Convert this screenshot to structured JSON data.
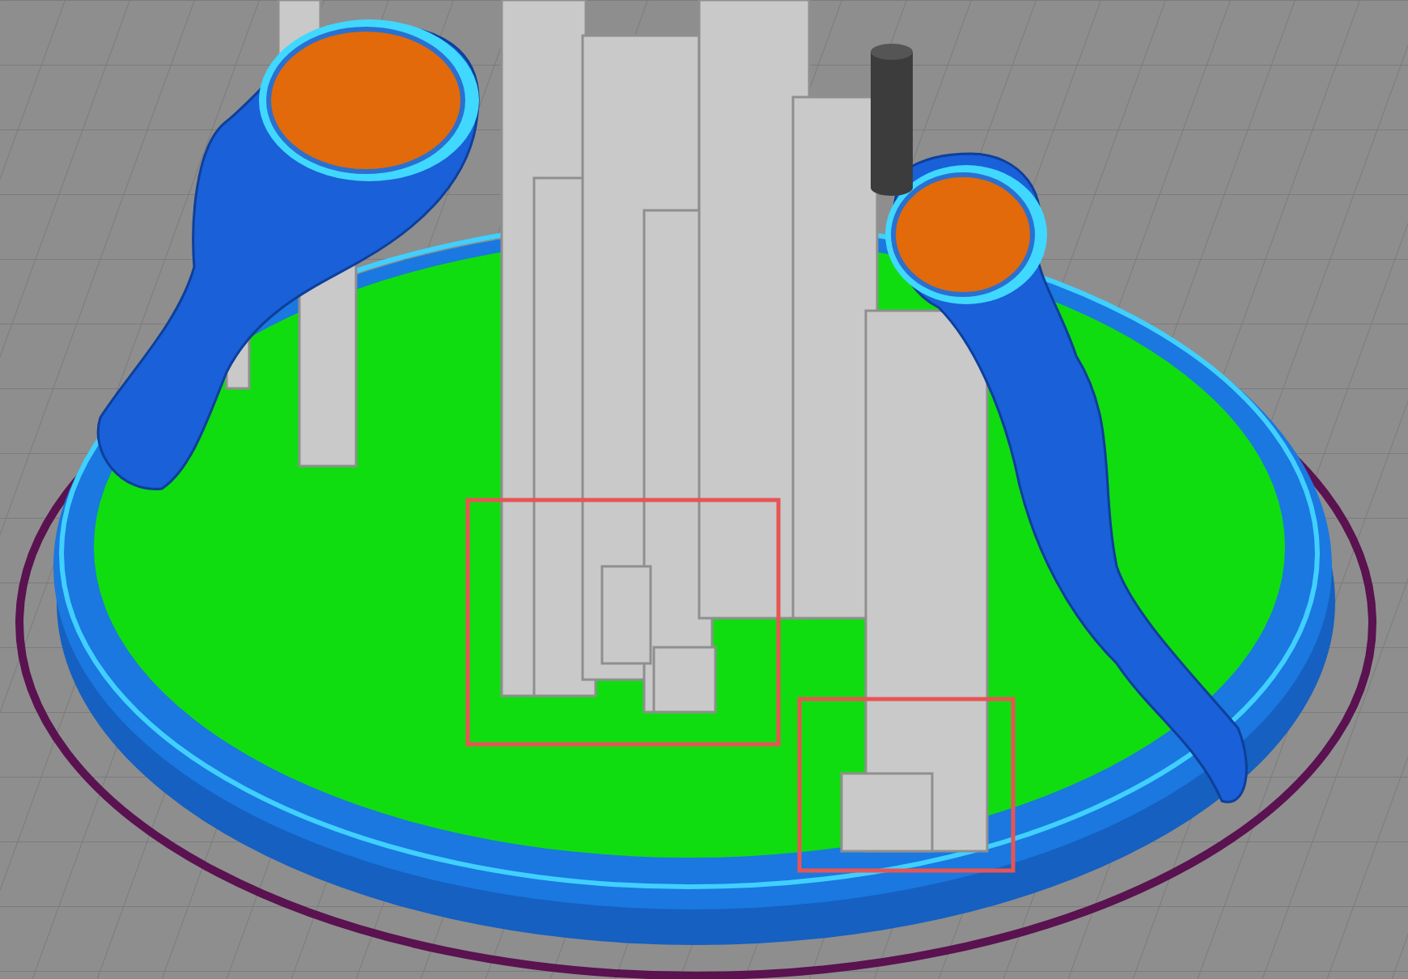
{
  "highlights": [
    {
      "kind": "rectangle"
    },
    {
      "kind": "rectangle"
    }
  ]
}
